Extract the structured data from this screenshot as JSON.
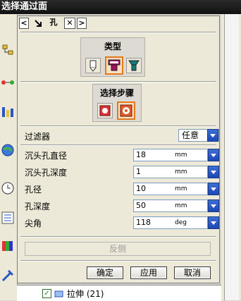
{
  "window": {
    "title": "选择通过面"
  },
  "tabs": {
    "hole_label": "孔"
  },
  "type_group": {
    "title": "类型"
  },
  "steps_group": {
    "title": "选择步骤"
  },
  "filter": {
    "label": "过滤器",
    "value": "任意"
  },
  "fields": [
    {
      "label": "沉头孔直径",
      "value": "18",
      "unit": "mm"
    },
    {
      "label": "沉头孔深度",
      "value": "1",
      "unit": "mm"
    },
    {
      "label": "孔径",
      "value": "10",
      "unit": "mm"
    },
    {
      "label": "孔深度",
      "value": "50",
      "unit": "mm"
    },
    {
      "label": "尖角",
      "value": "118",
      "unit": "deg"
    }
  ],
  "buttons": {
    "reverse": "反侧",
    "ok": "确定",
    "apply": "应用",
    "cancel": "取消"
  },
  "tree": {
    "item_label": "拉伸 (21)"
  },
  "colors": {
    "accent": "#e07a1a",
    "dropdown": "#2a56c6",
    "titlebar": "#1a1a1a"
  }
}
